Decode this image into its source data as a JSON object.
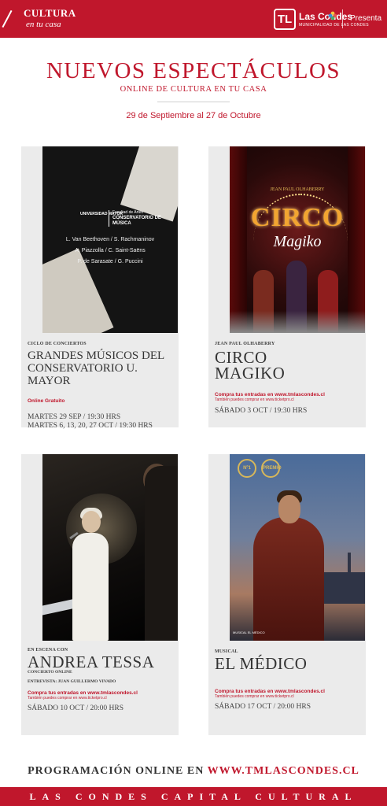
{
  "header": {
    "brand_line1": "CULTURA",
    "brand_line2": "en tu casa",
    "logo_mark": "TL",
    "logo_text": "Las Condes",
    "logo_sub": "MUNICIPALIDAD DE LAS CONDES",
    "presents": "Presenta",
    "accent_color": "#c0172c"
  },
  "intro": {
    "title": "NUEVOS ESPECTÁCULOS",
    "subtitle": "ONLINE DE CULTURA EN TU CASA",
    "dates": "29 de Septiembre al 27 de Octubre"
  },
  "cards": [
    {
      "kicker": "CICLO DE CONCIERTOS",
      "name": "GRANDES MÚSICOS DEL CONSERVATORIO U. MAYOR",
      "note": "Online Gratuito",
      "schedule": [
        "MARTES 29 SEP / 19:30 HRS",
        "MARTES 6, 13, 20, 27 OCT / 19:30 HRS"
      ],
      "poster": {
        "uni": "UNIVERSIDAD MAYOR",
        "faculty": "Facultad de Artes",
        "school": "CONSERVATORIO DE MÚSICA",
        "composers": [
          "L. Van Beethoven / S. Rachmaninov",
          "A. Piazzolla / C. Saint-Saëns",
          "P. de Sarasate / G. Puccini"
        ]
      }
    },
    {
      "kicker": "JEAN PAUL OLHABERRY",
      "name": "CIRCO MAGIKO",
      "tickets": "Compra tus entradas en www.tmlascondes.cl",
      "tickets_alt": "También puedes comprar en www.ticketpro.cl",
      "schedule": [
        "SÁBADO 3 OCT / 19:30 HRS"
      ],
      "poster": {
        "byline": "JEAN PAUL OLHABERRY",
        "title_a": "CIRCO",
        "title_b": "Magiko"
      }
    },
    {
      "kicker": "EN ESCENA CON",
      "name": "ANDREA TESSA",
      "sub": "CONCIERTO ONLINE",
      "interview": "ENTREVISTA: JUAN GUILLERMO VIVADO",
      "tickets": "Compra tus entradas en www.tmlascondes.cl",
      "tickets_alt": "También puedes comprar en www.ticketpro.cl",
      "schedule": [
        "SÁBADO 10 OCT / 20:00 HRS"
      ]
    },
    {
      "kicker": "MUSICAL",
      "name": "EL MÉDICO",
      "tickets": "Compra tus entradas en www.tmlascondes.cl",
      "tickets_alt": "También puedes comprar en www.ticketpro.cl",
      "schedule": [
        "SÁBADO 17 OCT / 20:00 HRS"
      ],
      "poster": {
        "award1": "Nº1",
        "award2": "PREMIO",
        "footer": "MUSICAL EL MÉDICO"
      }
    }
  ],
  "footer": {
    "prefix": "PROGRAMACIÓN ONLINE EN",
    "url": "WWW.TMLASCONDES.CL",
    "tagline": "LAS CONDES CAPITAL CULTURAL"
  }
}
